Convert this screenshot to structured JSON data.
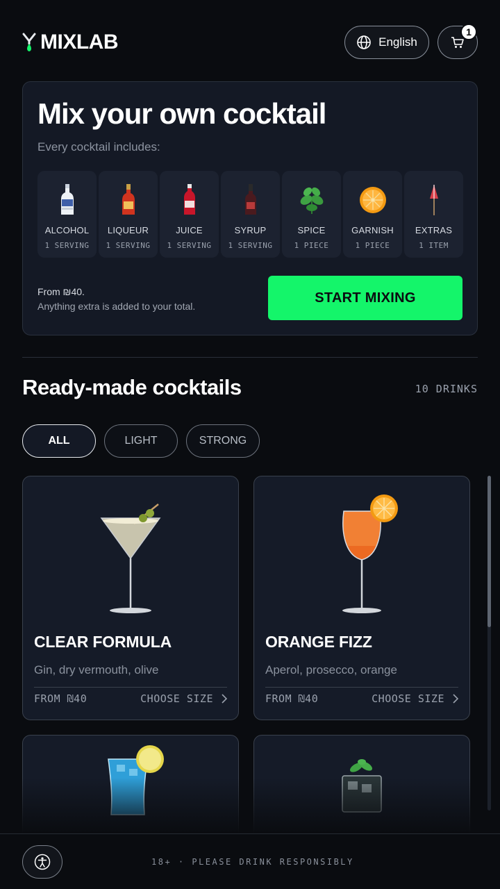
{
  "header": {
    "logo_text": "MIXLAB",
    "language_label": "English",
    "cart_count": "1"
  },
  "hero": {
    "title": "Mix your own cocktail",
    "subtitle": "Every cocktail includes:",
    "ingredients": [
      {
        "name": "ALCOHOL",
        "qty": "1 SERVING",
        "icon": "vodka-bottle-icon"
      },
      {
        "name": "LIQUEUR",
        "qty": "1 SERVING",
        "icon": "liqueur-bottle-icon"
      },
      {
        "name": "JUICE",
        "qty": "1 SERVING",
        "icon": "juice-bottle-icon"
      },
      {
        "name": "SYRUP",
        "qty": "1 SERVING",
        "icon": "syrup-bottle-icon"
      },
      {
        "name": "SPICE",
        "qty": "1 PIECE",
        "icon": "mint-icon"
      },
      {
        "name": "GARNISH",
        "qty": "1 PIECE",
        "icon": "orange-slice-icon"
      },
      {
        "name": "EXTRAS",
        "qty": "1 ITEM",
        "icon": "cocktail-umbrella-icon"
      }
    ],
    "price_from": "From ₪40.",
    "price_note": "Anything extra is added to your total.",
    "start_label": "START MIXING"
  },
  "ready": {
    "title": "Ready-made cocktails",
    "count": "10 DRINKS",
    "filters": [
      {
        "label": "ALL",
        "active": true
      },
      {
        "label": "LIGHT",
        "active": false
      },
      {
        "label": "STRONG",
        "active": false
      }
    ],
    "cards": [
      {
        "name": "CLEAR FORMULA",
        "desc": "Gin, dry vermouth, olive",
        "price": "FROM ₪40",
        "size": "CHOOSE SIZE"
      },
      {
        "name": "ORANGE FIZZ",
        "desc": "Aperol, prosecco, orange",
        "price": "FROM ₪40",
        "size": "CHOOSE SIZE"
      },
      {
        "name": "",
        "desc": "",
        "price": "",
        "size": ""
      },
      {
        "name": "",
        "desc": "",
        "price": "",
        "size": ""
      }
    ]
  },
  "footer": {
    "text": "18+ · PLEASE DRINK RESPONSIBLY"
  },
  "colors": {
    "accent": "#14f56a",
    "background": "#0a0c10",
    "card": "#151b28"
  }
}
